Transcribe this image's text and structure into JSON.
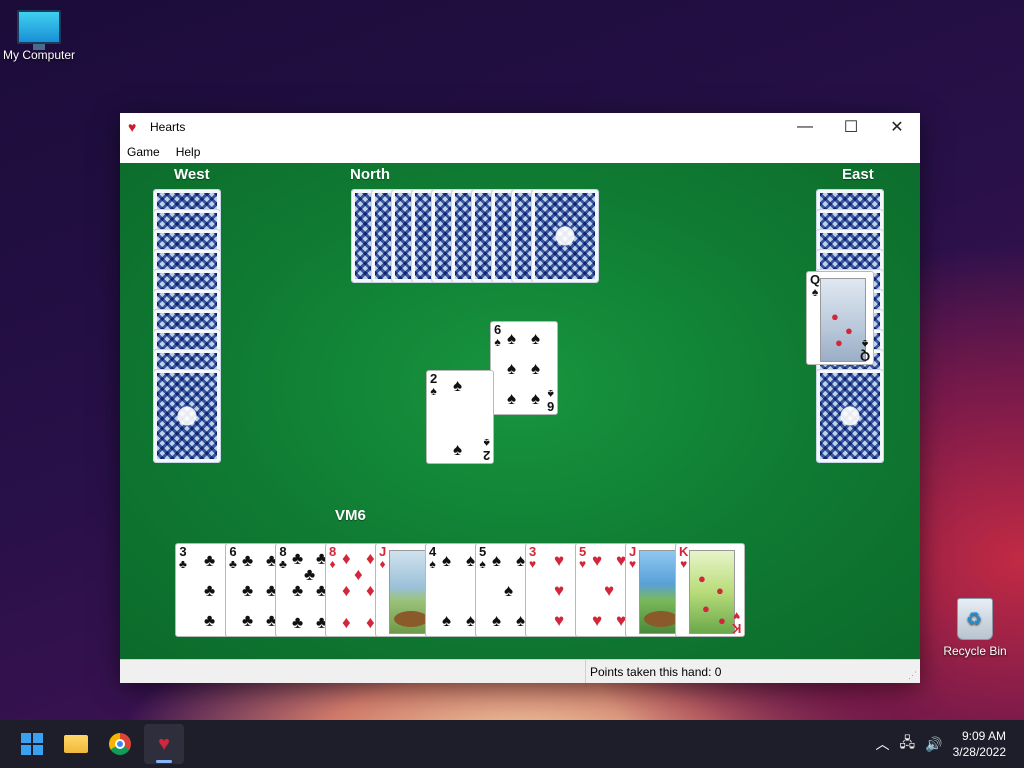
{
  "desktop": {
    "icons": [
      {
        "label": "My Computer"
      },
      {
        "label": "Recycle Bin"
      }
    ]
  },
  "window": {
    "title": "Hearts",
    "menu": [
      "Game",
      "Help"
    ],
    "controls": {
      "minimize": "—",
      "maximize": "☐",
      "close": "✕"
    }
  },
  "game": {
    "players": {
      "west": "West",
      "north": "North",
      "east": "East",
      "south": "VM6"
    },
    "west_cards_count": 11,
    "north_cards_count": 11,
    "east_cards_count": 11,
    "trick": [
      {
        "rank": "6",
        "suit": "♠",
        "player": "North"
      },
      {
        "rank": "2",
        "suit": "♠",
        "player": "South"
      },
      {
        "rank": "Q",
        "suit": "♠",
        "player": "East"
      }
    ],
    "hand": [
      {
        "rank": "3",
        "suit": "♣"
      },
      {
        "rank": "6",
        "suit": "♣"
      },
      {
        "rank": "8",
        "suit": "♣"
      },
      {
        "rank": "8",
        "suit": "♦"
      },
      {
        "rank": "J",
        "suit": "♦"
      },
      {
        "rank": "4",
        "suit": "♠"
      },
      {
        "rank": "5",
        "suit": "♠"
      },
      {
        "rank": "3",
        "suit": "♥"
      },
      {
        "rank": "5",
        "suit": "♥"
      },
      {
        "rank": "J",
        "suit": "♥"
      },
      {
        "rank": "K",
        "suit": "♥"
      }
    ],
    "status": "Points taken this hand: 0"
  },
  "taskbar": {
    "apps": [
      "start",
      "file-explorer",
      "chrome",
      "hearts"
    ],
    "time": "9:09 AM",
    "date": "3/28/2022"
  }
}
